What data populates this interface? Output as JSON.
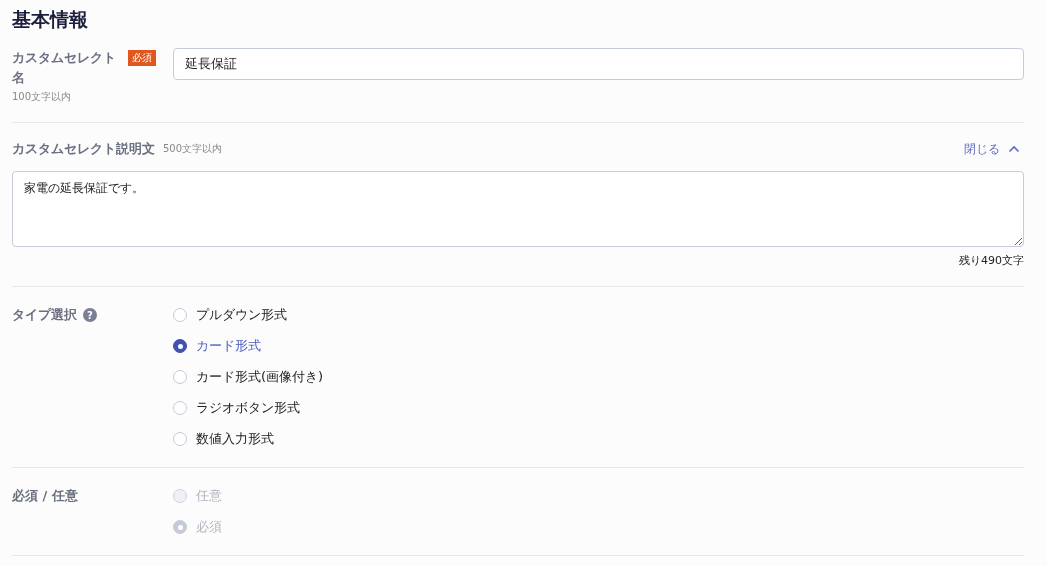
{
  "title": "基本情報",
  "name_field": {
    "label": "カスタムセレクト名",
    "badge": "必須",
    "hint": "100文字以内",
    "value": "延長保証"
  },
  "description": {
    "label": "カスタムセレクト説明文",
    "hint": "500文字以内",
    "toggle": "閉じる",
    "expanded": true,
    "value": "家電の延長保証です。",
    "counter": "残り490文字"
  },
  "type_select": {
    "label": "タイプ選択",
    "help": "?",
    "disabled": false,
    "options": [
      {
        "label": "プルダウン形式",
        "selected": false
      },
      {
        "label": "カード形式",
        "selected": true
      },
      {
        "label": "カード形式(画像付き)",
        "selected": false
      },
      {
        "label": "ラジオボタン形式",
        "selected": false
      },
      {
        "label": "数値入力形式",
        "selected": false
      }
    ]
  },
  "required_select": {
    "label": "必須 / 任意",
    "disabled": true,
    "options": [
      {
        "label": "任意",
        "selected": false
      },
      {
        "label": "必須",
        "selected": true
      }
    ]
  }
}
